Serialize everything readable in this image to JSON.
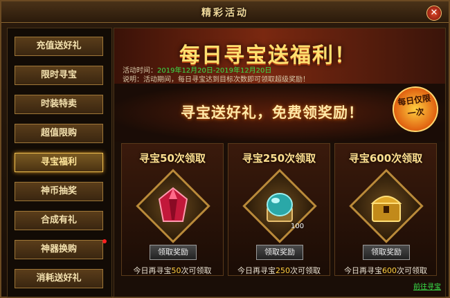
{
  "window": {
    "title": "精彩活动"
  },
  "sidebar": {
    "items": [
      {
        "label": "充值送好礼"
      },
      {
        "label": "限时寻宝"
      },
      {
        "label": "时装特卖"
      },
      {
        "label": "超值限购"
      },
      {
        "label": "寻宝福利",
        "active": true
      },
      {
        "label": "神币抽奖"
      },
      {
        "label": "合成有礼"
      },
      {
        "label": "神器换购",
        "has_dot": true
      },
      {
        "label": "消耗送好礼"
      }
    ]
  },
  "banner": {
    "title": "每日寻宝送福利！",
    "time_label": "活动时间：",
    "time_value": "2019年12月20日-2019年12月20日",
    "desc_label": "说明：",
    "desc_value": "活动期间，每日寻宝达到目标次数即可领取超级奖励！"
  },
  "promo": {
    "slogan": "寻宝送好礼，免费领奖励！",
    "badge_line1": "每日仅限",
    "badge_line2": "一次"
  },
  "cards": [
    {
      "title": "寻宝50次领取",
      "icon": "ruby-gem-icon",
      "count": "",
      "button": "领取奖励",
      "remain_pre": "今日再寻宝",
      "remain_num": "50",
      "remain_post": "次可领取"
    },
    {
      "title": "寻宝250次领取",
      "icon": "teal-orb-chest-icon",
      "count": "100",
      "button": "领取奖励",
      "remain_pre": "今日再寻宝",
      "remain_num": "250",
      "remain_post": "次可领取"
    },
    {
      "title": "寻宝600次领取",
      "icon": "golden-chest-icon",
      "count": "",
      "button": "领取奖励",
      "remain_pre": "今日再寻宝",
      "remain_num": "600",
      "remain_post": "次可领取"
    }
  ],
  "footer": {
    "link": "前往寻宝"
  },
  "colors": {
    "accent_green": "#39e24a",
    "gold": "#ffe070",
    "highlight_yellow": "#ffd040"
  }
}
